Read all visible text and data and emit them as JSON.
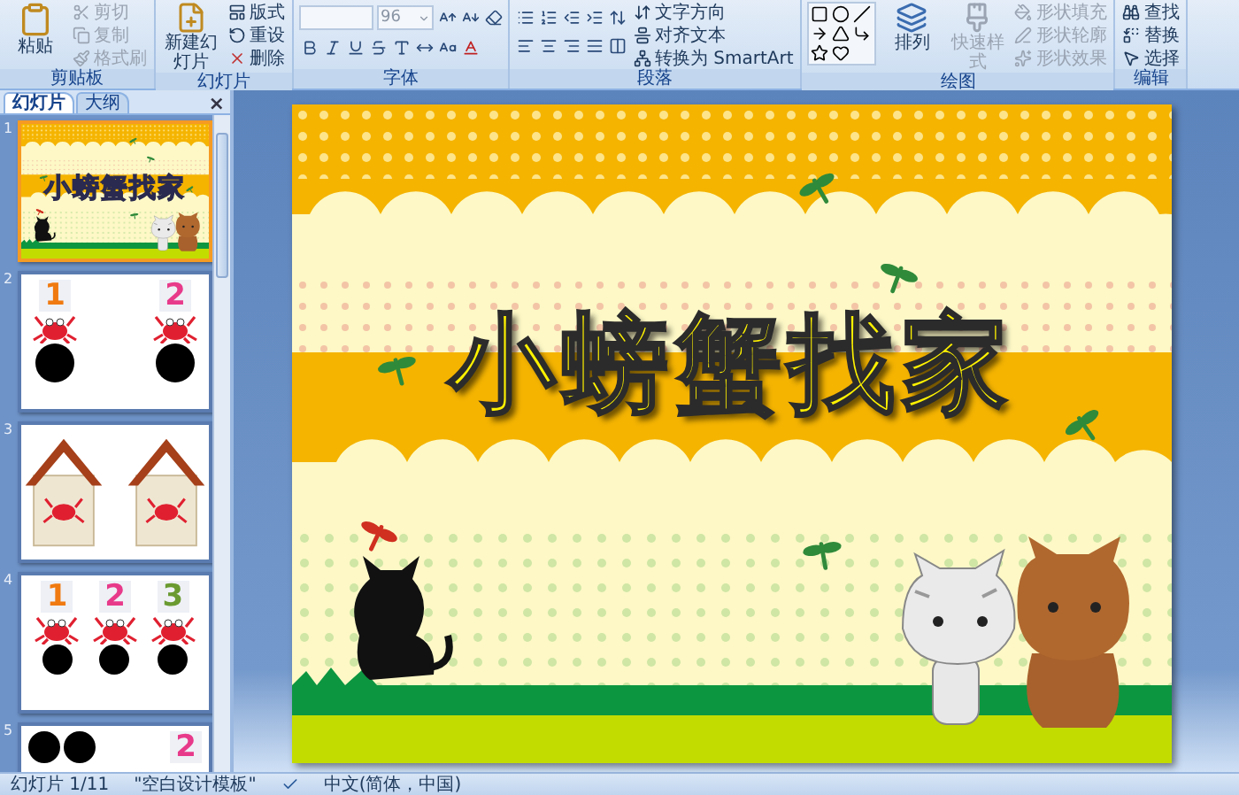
{
  "ribbon": {
    "groups": [
      {
        "kind": "clipboard",
        "label": "剪贴板",
        "items": [
          {
            "label": "粘贴",
            "disabled": false
          },
          {
            "label": "剪切",
            "disabled": true
          },
          {
            "label": "复制",
            "disabled": true
          },
          {
            "label": "格式刷",
            "disabled": true
          }
        ]
      },
      {
        "kind": "slides",
        "label": "幻灯片",
        "items": [
          {
            "label": "新建幻灯片",
            "disabled": false
          },
          {
            "label": "版式",
            "disabled": false
          },
          {
            "label": "重设",
            "disabled": false
          },
          {
            "label": "删除",
            "disabled": false
          }
        ]
      },
      {
        "kind": "font",
        "label": "字体",
        "font_size": "96"
      },
      {
        "kind": "paragraph",
        "label": "段落",
        "items": [
          {
            "label": "文字方向",
            "disabled": false
          },
          {
            "label": "对齐文本",
            "disabled": false
          },
          {
            "label": "转换为 SmartArt",
            "disabled": false
          }
        ]
      },
      {
        "kind": "drawing",
        "label": "绘图",
        "items": [
          {
            "label": "排列",
            "disabled": false
          },
          {
            "label": "快速样式",
            "disabled": true
          },
          {
            "label": "形状填充",
            "disabled": true
          },
          {
            "label": "形状轮廓",
            "disabled": true
          },
          {
            "label": "形状效果",
            "disabled": true
          }
        ]
      },
      {
        "kind": "editing",
        "label": "编辑",
        "items": [
          {
            "label": "查找",
            "disabled": false
          },
          {
            "label": "替换",
            "disabled": false
          },
          {
            "label": "选择",
            "disabled": false
          }
        ]
      }
    ]
  },
  "panel": {
    "tabs": [
      {
        "label": "幻灯片",
        "selected": true
      },
      {
        "label": "大纲",
        "selected": false
      }
    ],
    "close": "×"
  },
  "thumbnails": [
    {
      "number": "1",
      "kind": "title",
      "selected": true,
      "title": "小螃蟹找家"
    },
    {
      "number": "2",
      "kind": "crabs",
      "selected": false,
      "numerals": [
        {
          "text": "1",
          "color": "#f07a10"
        },
        {
          "text": "2",
          "color": "#e83a8a"
        }
      ]
    },
    {
      "number": "3",
      "kind": "houses",
      "selected": false
    },
    {
      "number": "4",
      "kind": "crabs",
      "selected": false,
      "numerals": [
        {
          "text": "1",
          "color": "#f07a10"
        },
        {
          "text": "2",
          "color": "#e83a8a"
        },
        {
          "text": "3",
          "color": "#6a9a30"
        }
      ]
    },
    {
      "number": "5",
      "kind": "circles",
      "selected": false,
      "numerals": [
        {
          "text": "2",
          "color": "#e83a8a"
        }
      ]
    }
  ],
  "slide": {
    "title": "小螃蟹找家"
  },
  "status_bar": {
    "slide": "幻灯片 1/11",
    "theme": "\"空白设计模板\"",
    "language": "中文(简体，中国)"
  }
}
